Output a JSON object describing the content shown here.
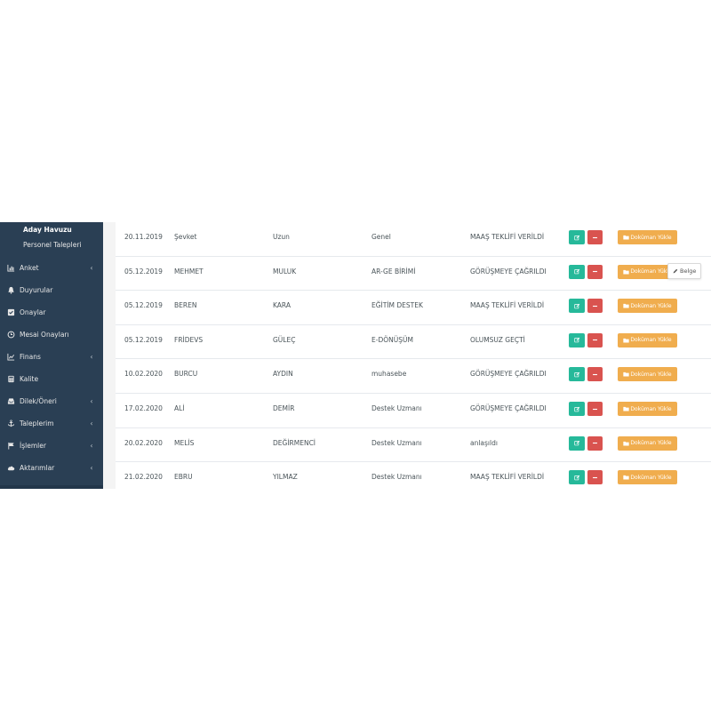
{
  "colors": {
    "sidebar_bg": "#2a3f54",
    "edit_button": "#26b99a",
    "delete_button": "#d9534f",
    "document_button": "#f0ad4e"
  },
  "sidebar": {
    "sub_items": [
      {
        "label": "Aday Havuzu",
        "active": true
      },
      {
        "label": "Personel Talepleri",
        "active": false
      }
    ],
    "items": [
      {
        "label": "Anket",
        "icon": "bar-chart-icon",
        "has_submenu": true
      },
      {
        "label": "Duyurular",
        "icon": "bell-icon",
        "has_submenu": false
      },
      {
        "label": "Onaylar",
        "icon": "check-square-icon",
        "has_submenu": false
      },
      {
        "label": "Mesai Onayları",
        "icon": "clock-icon",
        "has_submenu": false
      },
      {
        "label": "Finans",
        "icon": "line-chart-icon",
        "has_submenu": true
      },
      {
        "label": "Kalite",
        "icon": "calculator-icon",
        "has_submenu": false
      },
      {
        "label": "Dilek/Öneri",
        "icon": "inbox-icon",
        "has_submenu": true
      },
      {
        "label": "Taleplerim",
        "icon": "anchor-icon",
        "has_submenu": true
      },
      {
        "label": "İşlemler",
        "icon": "flag-icon",
        "has_submenu": true
      },
      {
        "label": "Aktarımlar",
        "icon": "cloud-icon",
        "has_submenu": true
      }
    ]
  },
  "table": {
    "document_button_label": "Doküman Yükle",
    "rows": [
      {
        "date": "20.11.2019",
        "first_name": "Şevket",
        "last_name": "Uzun",
        "department": "Genel",
        "status": "MAAŞ TEKLİFİ VERİLDİ"
      },
      {
        "date": "05.12.2019",
        "first_name": "MEHMET",
        "last_name": "MULUK",
        "department": "AR-GE BİRİMİ",
        "status": "GÖRÜŞMEYE ÇAĞRILDI"
      },
      {
        "date": "05.12.2019",
        "first_name": "BEREN",
        "last_name": "KARA",
        "department": "EĞİTİM DESTEK",
        "status": "MAAŞ TEKLİFİ VERİLDİ"
      },
      {
        "date": "05.12.2019",
        "first_name": "FRİDEVS",
        "last_name": "GÜLEÇ",
        "department": "E-DÖNÜŞÜM",
        "status": "OLUMSUZ GEÇTİ"
      },
      {
        "date": "10.02.2020",
        "first_name": "BURCU",
        "last_name": "AYDIN",
        "department": "muhasebe",
        "status": "GÖRÜŞMEYE ÇAĞRILDI"
      },
      {
        "date": "17.02.2020",
        "first_name": "ALİ",
        "last_name": "DEMİR",
        "department": "Destek Uzmanı",
        "status": "GÖRÜŞMEYE ÇAĞRILDI"
      },
      {
        "date": "20.02.2020",
        "first_name": "MELİS",
        "last_name": "DEĞİRMENCİ",
        "department": "Destek Uzmanı",
        "status": "anlaşıldı"
      },
      {
        "date": "21.02.2020",
        "first_name": "EBRU",
        "last_name": "YILMAZ",
        "department": "Destek Uzmanı",
        "status": "MAAŞ TEKLİFİ VERİLDİ"
      }
    ]
  },
  "tooltip": {
    "label": "Belge",
    "icon": "pencil-icon"
  }
}
